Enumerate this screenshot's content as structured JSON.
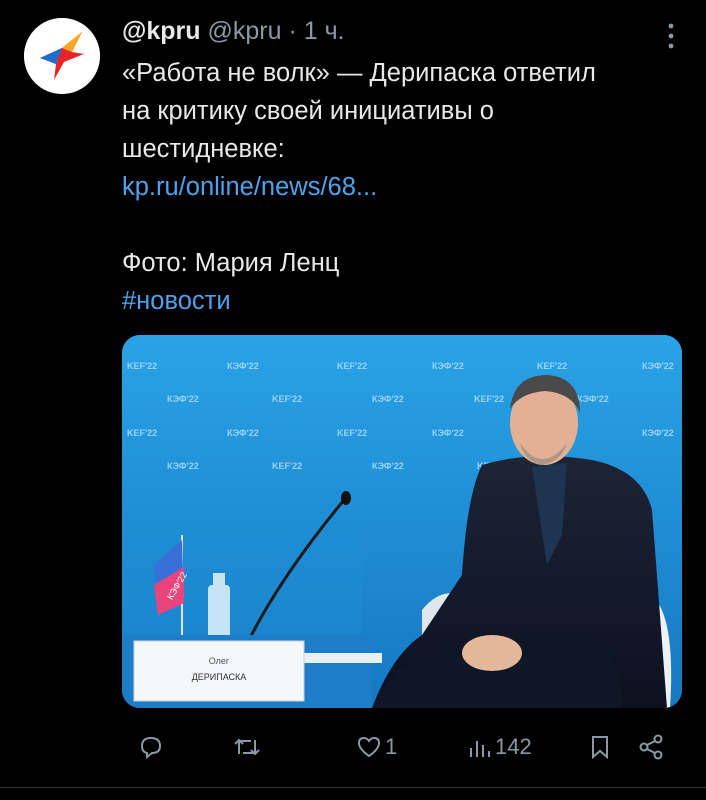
{
  "tweet": {
    "display_name": "@kpru",
    "handle": "@kpru",
    "time": "· 1 ч.",
    "text_lines": [
      "«Работа не волк» — Дерипаска ответил",
      "на критику своей инициативы о",
      "шестидневке:"
    ],
    "link": "kp.ru/online/news/68...",
    "photo_credit": "Фото: Мария Ленц",
    "hashtag": "#новости",
    "media": {
      "nameplate_first": "Олег",
      "nameplate_last": "ДЕРИПАСКА",
      "flag_text": "КЭФ'22",
      "banner_a": "KEF'22",
      "banner_b": "КЭФ'22"
    },
    "actions": {
      "reply_count": "",
      "retweet_count": "",
      "like_count": "1",
      "views_count": "142"
    }
  },
  "colors": {
    "background": "#000000",
    "text": "#e7e9ea",
    "muted": "#8b98a5",
    "link": "#4ea3ec",
    "brand": "#e8242b"
  }
}
